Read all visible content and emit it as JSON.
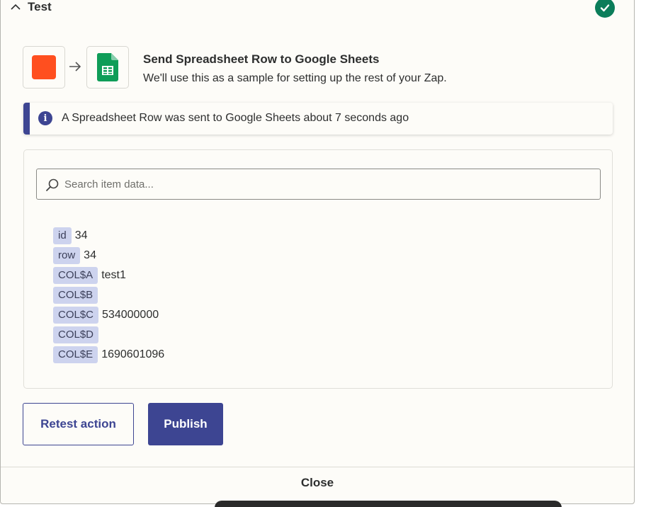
{
  "header": {
    "title": "Test",
    "status": "success"
  },
  "step": {
    "title": "Send Spreadsheet Row to Google Sheets",
    "subtitle": "We'll use this as a sample for setting up the rest of your Zap."
  },
  "info": {
    "message": "A Spreadsheet Row was sent to Google Sheets about 7 seconds ago"
  },
  "search": {
    "placeholder": "Search item data..."
  },
  "items": [
    {
      "key": "id",
      "value": "34"
    },
    {
      "key": "row",
      "value": "34"
    },
    {
      "key": "COL$A",
      "value": "test1"
    },
    {
      "key": "COL$B",
      "value": ""
    },
    {
      "key": "COL$C",
      "value": "534000000"
    },
    {
      "key": "COL$D",
      "value": ""
    },
    {
      "key": "COL$E",
      "value": "1690601096"
    }
  ],
  "buttons": {
    "retest": "Retest action",
    "publish": "Publish"
  },
  "footer": {
    "close": "Close"
  },
  "colors": {
    "accent": "#3d4592",
    "trigger_app": "#ff4f1f",
    "sheets_green": "#0f9d58",
    "success": "#0b7d5a"
  },
  "icons": [
    "chevron-up-icon",
    "check-circle-icon",
    "arrow-right-icon",
    "google-sheets-icon",
    "info-icon",
    "search-icon"
  ]
}
